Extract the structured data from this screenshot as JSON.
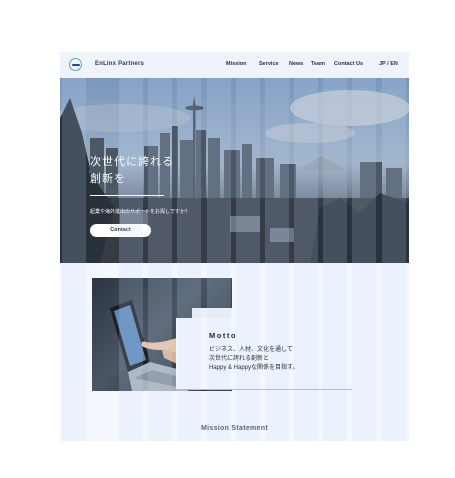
{
  "header": {
    "brand": "EnLinx Partners",
    "nav": [
      {
        "label": "Mission"
      },
      {
        "label": "Service"
      },
      {
        "label": "News"
      },
      {
        "label": "Team"
      },
      {
        "label": "Contact Us"
      },
      {
        "label": "JP / EN"
      }
    ]
  },
  "hero": {
    "title_line1": "次世代に誇れる",
    "title_line2": "創新を",
    "subtitle": "起業や海外進出のサポートをお探しですか？",
    "button_label": "Contact"
  },
  "motto": {
    "title": "Motto",
    "line1": "ビジネス、人材、文化を通して",
    "line2": "次世代に誇れる創新と",
    "line3": "Happy & Happyな関係を目指す。"
  },
  "mission": {
    "section_title": "Mission Statement"
  },
  "colors": {
    "page_background": "#f4f7fd",
    "logo_green": "#49b59b",
    "text_dark": "#1f2733"
  }
}
